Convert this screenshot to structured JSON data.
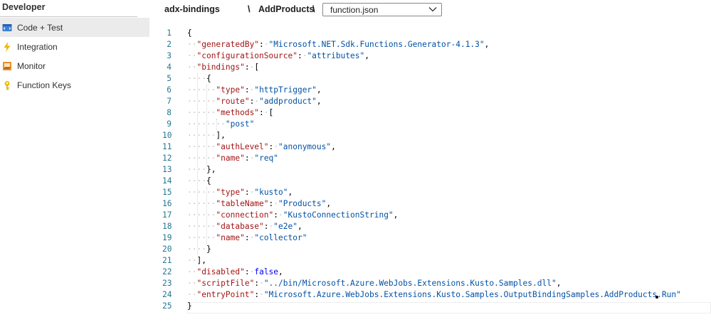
{
  "sidebar": {
    "header": "Developer",
    "items": [
      {
        "label": "Code + Test",
        "icon": "code-test-icon",
        "active": true
      },
      {
        "label": "Integration",
        "icon": "lightning-icon",
        "active": false
      },
      {
        "label": "Monitor",
        "icon": "monitor-icon",
        "active": false
      },
      {
        "label": "Function Keys",
        "icon": "key-icon",
        "active": false
      }
    ]
  },
  "breadcrumb": {
    "app": "adx-bindings",
    "separator": "\\",
    "function": "AddProducts"
  },
  "file_select": {
    "value": "function.json"
  },
  "editor": {
    "lines": [
      "{",
      "  \"generatedBy\": \"Microsoft.NET.Sdk.Functions.Generator-4.1.3\",",
      "  \"configurationSource\": \"attributes\",",
      "  \"bindings\": [",
      "    {",
      "      \"type\": \"httpTrigger\",",
      "      \"route\": \"addproduct\",",
      "      \"methods\": [",
      "        \"post\"",
      "      ],",
      "      \"authLevel\": \"anonymous\",",
      "      \"name\": \"req\"",
      "    },",
      "    {",
      "      \"type\": \"kusto\",",
      "      \"tableName\": \"Products\",",
      "      \"connection\": \"KustoConnectionString\",",
      "      \"database\": \"e2e\",",
      "      \"name\": \"collector\"",
      "    }",
      "  ],",
      "  \"disabled\": false,",
      "  \"scriptFile\": \"../bin/Microsoft.Azure.WebJobs.Extensions.Kusto.Samples.dll\",",
      "  \"entryPoint\": \"Microsoft.Azure.WebJobs.Extensions.Kusto.Samples.OutputBindingSamples.AddProducts.Run\"",
      "}"
    ]
  },
  "colors": {
    "key": "#a31515",
    "string": "#0451a5",
    "keyword": "#0000ff",
    "line_number": "#237893",
    "active_nav_bg": "#ebebeb"
  }
}
